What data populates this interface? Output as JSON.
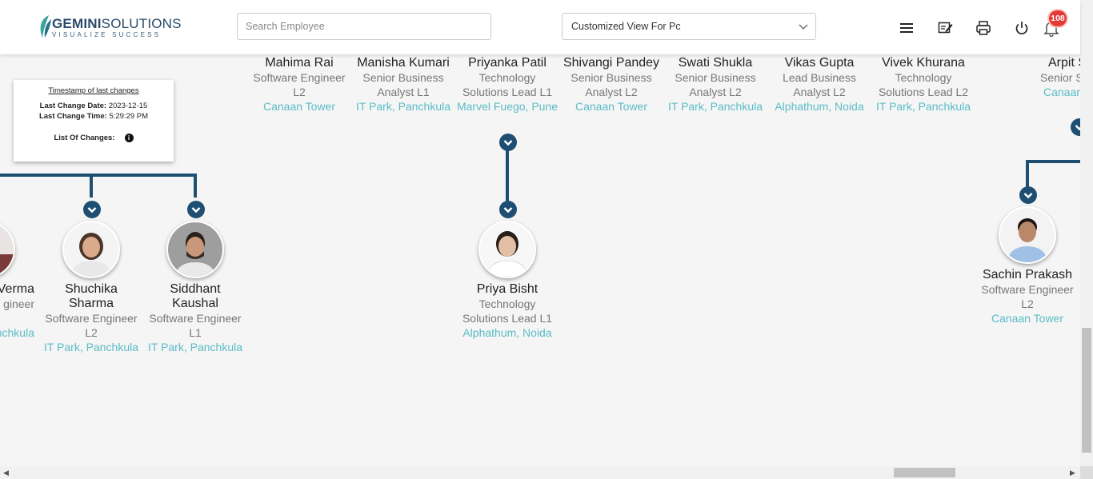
{
  "header": {
    "logo": {
      "brand": "GEMINI",
      "brand_suffix": "SOLUTIONS",
      "tagline": "VISUALIZE SUCCESS"
    },
    "search": {
      "placeholder": "Search Employee",
      "value": ""
    },
    "view_select": {
      "selected": "Customized View For Pc"
    },
    "icons": [
      "menu-icon",
      "edit-note-icon",
      "print-icon",
      "power-icon",
      "bell-icon"
    ],
    "notification_count": "108"
  },
  "timestamp": {
    "title": "Timestamp of last changes",
    "date_label": "Last Change Date:",
    "date_value": "2023-12-15",
    "time_label": "Last Change Time:",
    "time_value": "5:29:29 PM",
    "changes_label": "List Of Changes:"
  },
  "top_row": [
    {
      "name": "Mahima Rai",
      "role": "Software Engineer L2",
      "location": "Canaan Tower"
    },
    {
      "name": "Manisha Kumari",
      "role": "Senior Business Analyst L1",
      "location": "IT Park, Panchkula"
    },
    {
      "name": "Priyanka Patil",
      "role": "Technology Solutions Lead L1",
      "location": "Marvel Fuego, Pune"
    },
    {
      "name": "Shivangi Pandey",
      "role": "Senior Business Analyst L2",
      "location": "Canaan Tower"
    },
    {
      "name": "Swati Shukla",
      "role": "Senior Business Analyst L2",
      "location": "IT Park, Panchkula"
    },
    {
      "name": "Vikas Gupta",
      "role": "Lead Business Analyst L2",
      "location": "Alphathum, Noida"
    },
    {
      "name": "Vivek Khurana",
      "role": "Technology Solutions Lead L2",
      "location": "IT Park, Panchkula"
    },
    {
      "name": "Arpit S",
      "role": "Senior S Engin",
      "location": "Canaan"
    }
  ],
  "bottom_row": [
    {
      "name": "Verma",
      "role": "gineer",
      "location": "nchkula"
    },
    {
      "name": "Shuchika Sharma",
      "role": "Software Engineer L2",
      "location": "IT Park, Panchkula"
    },
    {
      "name": "Siddhant Kaushal",
      "role": "Software Engineer L1",
      "location": "IT Park, Panchkula"
    },
    {
      "name": "Priya Bisht",
      "role": "Technology Solutions Lead L1",
      "location": "Alphathum, Noida"
    },
    {
      "name": "Sachin Prakash",
      "role": "Software Engineer L2",
      "location": "Canaan Tower"
    }
  ],
  "colors": {
    "connector": "#1e4f73",
    "location": "#5bbcc6",
    "badge": "#e53935"
  }
}
